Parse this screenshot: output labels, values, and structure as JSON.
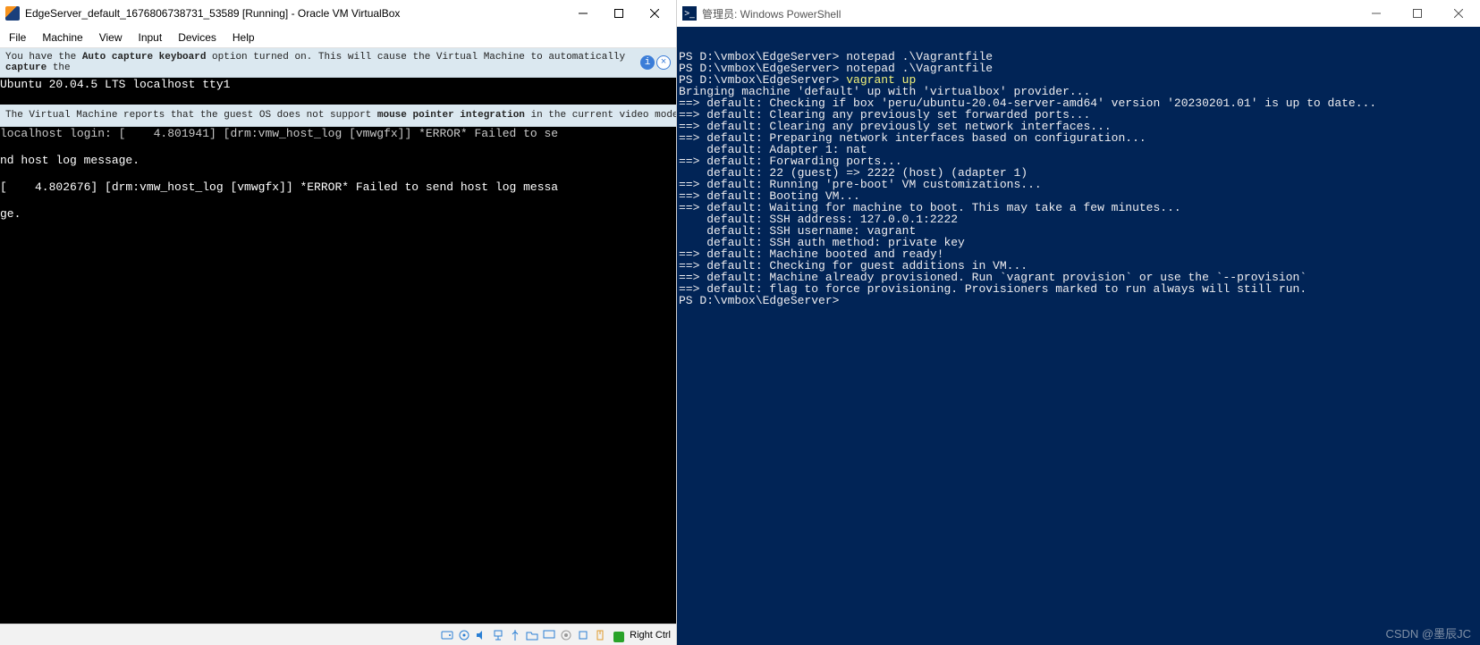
{
  "vbox": {
    "title": "EdgeServer_default_1676806738731_53589 [Running] - Oracle VM VirtualBox",
    "menu": [
      "File",
      "Machine",
      "View",
      "Input",
      "Devices",
      "Help"
    ],
    "notice1_pre": "You have the ",
    "notice1_bold1": "Auto capture keyboard",
    "notice1_mid": " option turned on. This will cause the Virtual Machine to automatically ",
    "notice1_bold2": "capture",
    "notice1_post": " the",
    "notice2_pre": "The Virtual Machine reports that the guest OS does not support ",
    "notice2_bold1": "mouse pointer integration",
    "notice2_post": " in the current video mode.",
    "console": {
      "l1": "Ubuntu 20.04.5 LTS localhost tty1",
      "l2": "localhost login: [    4.801941] [drm:vmw_host_log [vmwgfx]] *ERROR* Failed to se",
      "l3": "nd host log message.",
      "l4": "[    4.802676] [drm:vmw_host_log [vmwgfx]] *ERROR* Failed to send host log messa",
      "l5": "ge."
    },
    "hostkey": "Right Ctrl"
  },
  "ps": {
    "title": "管理员: Windows PowerShell",
    "lines": [
      {
        "p": "PS D:\\vmbox\\EdgeServer> ",
        "c": "notepad .\\Vagrantfile"
      },
      {
        "p": "PS D:\\vmbox\\EdgeServer> ",
        "c": "notepad .\\Vagrantfile"
      },
      {
        "p": "PS D:\\vmbox\\EdgeServer> ",
        "c": "vagrant up",
        "cy": true
      },
      {
        "t": "Bringing machine 'default' up with 'virtualbox' provider..."
      },
      {
        "t": "==> default: Checking if box 'peru/ubuntu-20.04-server-amd64' version '20230201.01' is up to date..."
      },
      {
        "t": "==> default: Clearing any previously set forwarded ports..."
      },
      {
        "t": "==> default: Clearing any previously set network interfaces..."
      },
      {
        "t": "==> default: Preparing network interfaces based on configuration..."
      },
      {
        "t": "    default: Adapter 1: nat"
      },
      {
        "t": "==> default: Forwarding ports..."
      },
      {
        "t": "    default: 22 (guest) => 2222 (host) (adapter 1)"
      },
      {
        "t": "==> default: Running 'pre-boot' VM customizations..."
      },
      {
        "t": "==> default: Booting VM..."
      },
      {
        "t": "==> default: Waiting for machine to boot. This may take a few minutes..."
      },
      {
        "t": "    default: SSH address: 127.0.0.1:2222"
      },
      {
        "t": "    default: SSH username: vagrant"
      },
      {
        "t": "    default: SSH auth method: private key"
      },
      {
        "t": "==> default: Machine booted and ready!"
      },
      {
        "t": "==> default: Checking for guest additions in VM..."
      },
      {
        "t": "==> default: Machine already provisioned. Run `vagrant provision` or use the `--provision`"
      },
      {
        "t": "==> default: flag to force provisioning. Provisioners marked to run always will still run."
      },
      {
        "p": "PS D:\\vmbox\\EdgeServer> ",
        "c": ""
      }
    ],
    "watermark": "CSDN @墨辰JC"
  }
}
